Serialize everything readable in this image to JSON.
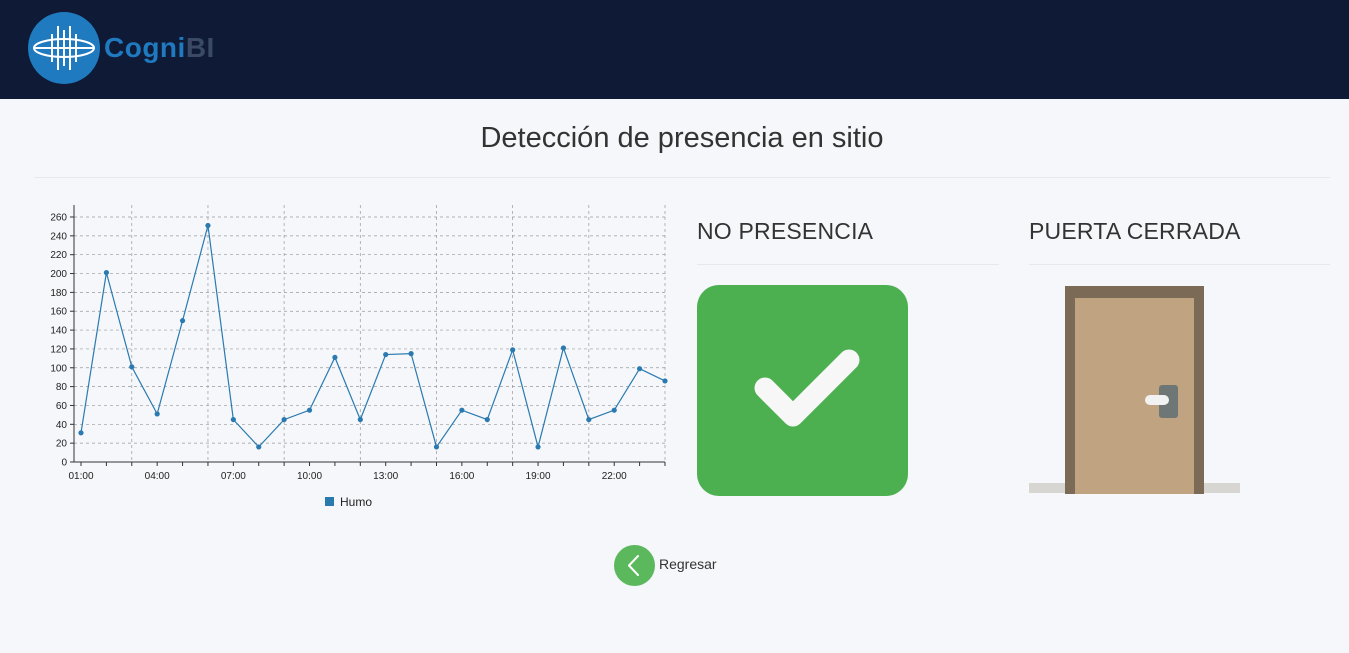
{
  "brand": {
    "name_part1": "Cogni",
    "name_part2": "BI",
    "logo_icon": "waveform-logo-icon"
  },
  "page": {
    "title": "Detección de presencia en sitio"
  },
  "presence": {
    "label": "NO PRESENCIA",
    "icon": "checkmark-icon",
    "color": "#4caf50"
  },
  "door": {
    "label": "PUERTA CERRADA",
    "icon": "closed-door-icon"
  },
  "back": {
    "label": "Regresar",
    "icon": "chevron-left-icon",
    "color": "#5cb85c"
  },
  "chart_data": {
    "type": "line",
    "title": "",
    "xlabel": "",
    "ylabel": "",
    "ylim": [
      0,
      260
    ],
    "yticks": [
      0,
      20,
      40,
      60,
      80,
      100,
      120,
      140,
      160,
      180,
      200,
      220,
      240,
      260
    ],
    "x": [
      "01:00",
      "02:00",
      "03:00",
      "04:00",
      "05:00",
      "06:00",
      "07:00",
      "08:00",
      "09:00",
      "10:00",
      "11:00",
      "12:00",
      "13:00",
      "14:00",
      "15:00",
      "16:00",
      "17:00",
      "18:00",
      "19:00",
      "20:00",
      "21:00",
      "22:00",
      "23:00",
      "24:00"
    ],
    "xtick_labels": [
      "01:00",
      "04:00",
      "07:00",
      "10:00",
      "13:00",
      "16:00",
      "19:00",
      "22:00"
    ],
    "series": [
      {
        "name": "Humo",
        "color": "#2a7ab0",
        "values": [
          31,
          201,
          101,
          51,
          150,
          251,
          45,
          16,
          45,
          55,
          111,
          45,
          114,
          115,
          16,
          55,
          45,
          119,
          16,
          121,
          45,
          55,
          99,
          86
        ]
      }
    ],
    "grid": true,
    "legend": "bottom-center"
  }
}
